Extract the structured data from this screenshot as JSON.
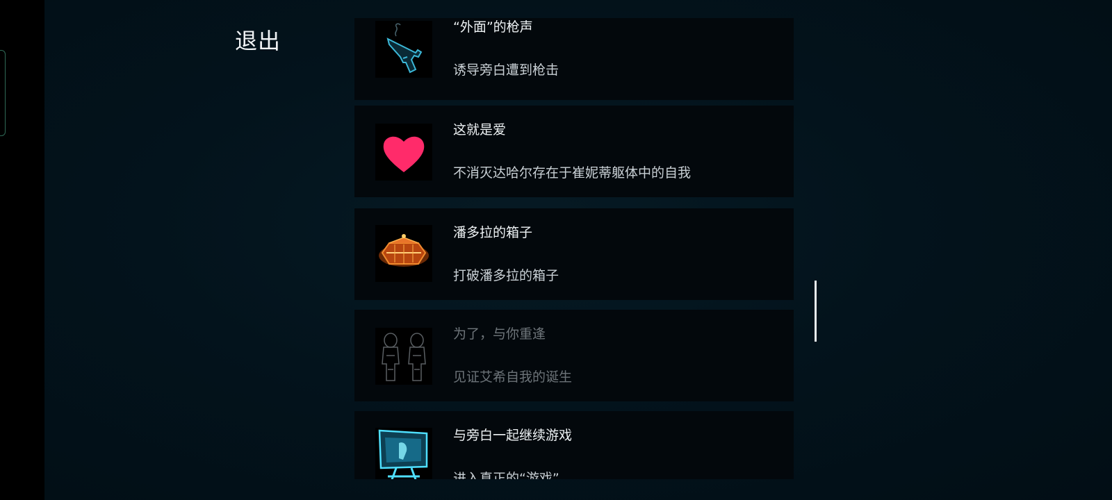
{
  "exit_label": "退出",
  "achievements": [
    {
      "title": "“外面”的枪声",
      "description": "诱导旁白遭到枪击",
      "icon": "pistol-icon",
      "locked": false
    },
    {
      "title": "这就是爱",
      "description": "不消灭达哈尔存在于崔妮蒂躯体中的自我",
      "icon": "heart-icon",
      "locked": false
    },
    {
      "title": "潘多拉的箱子",
      "description": "打破潘多拉的箱子",
      "icon": "pandora-box-icon",
      "locked": false
    },
    {
      "title": "为了，与你重逢",
      "description": "见证艾希自我的诞生",
      "icon": "twin-figures-icon",
      "locked": true
    },
    {
      "title": "与旁白一起继续游戏",
      "description": "进入真正的“游戏”",
      "icon": "monitor-icon",
      "locked": false
    }
  ],
  "colors": {
    "background": "#03131c",
    "card": "#03080c",
    "heart": "#ff2b6a",
    "cyan_icon": "#2ec7e6",
    "box_orange": "#e8621c"
  }
}
